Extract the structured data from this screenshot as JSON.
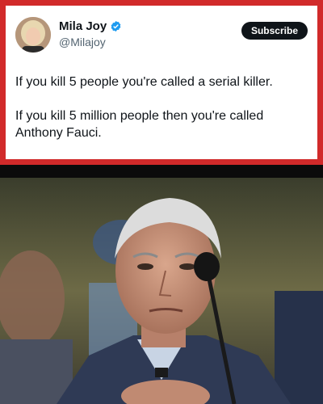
{
  "tweet": {
    "display_name": "Mila Joy",
    "handle": "@Milajoy",
    "subscribe_label": "Subscribe",
    "verified_icon": "verified-badge-icon",
    "paragraphs": [
      "If you kill 5 people you're called a serial killer.",
      "If you kill 5 million people then you're called Anthony Fauci."
    ]
  },
  "colors": {
    "frame": "#d12a2a",
    "verified": "#1d9bf0",
    "subscribe_bg": "#0f1419"
  }
}
